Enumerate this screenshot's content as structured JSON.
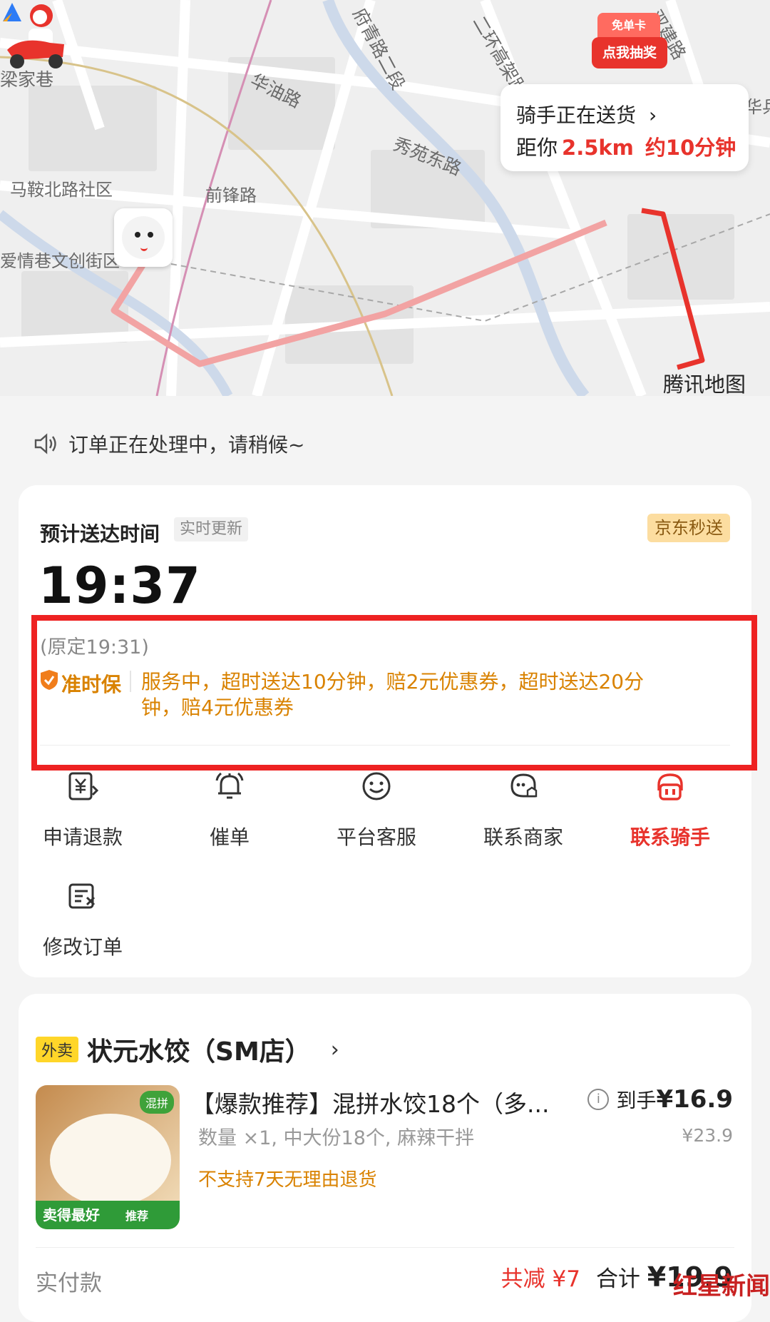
{
  "map": {
    "streets": [
      "梁家巷",
      "华油路",
      "府青路二段",
      "二环高架路",
      "双建路",
      "秀苑东路",
      "马鞍北路社区",
      "前锋路",
      "爱情巷文创街区",
      "华乒"
    ],
    "coupon": {
      "top": "免单卡",
      "bottom": "点我抽奖"
    },
    "rider": {
      "status": "骑手正在送货",
      "chevron": "›",
      "distance_prefix": "距你",
      "distance": "2.5km",
      "eta": "约10分钟"
    },
    "provider": "腾讯地图",
    "route_color": "#f28c8c",
    "active_route_color": "#e8332c"
  },
  "notice": "订单正在处理中，请稍候~",
  "delivery": {
    "eta_label": "预计送达时间",
    "realtime_tag": "实时更新",
    "brand_tag": "京东秒送",
    "eta": "19:37",
    "original": "(原定19:31)",
    "ontime_label": "准时保",
    "ontime_text": "服务中，超时送达10分钟，赔2元优惠券，超时送达20分钟，赔4元优惠券"
  },
  "actions": [
    {
      "label": "申请退款",
      "icon": "refund-icon"
    },
    {
      "label": "催单",
      "icon": "bell-icon"
    },
    {
      "label": "平台客服",
      "icon": "service-icon"
    },
    {
      "label": "联系商家",
      "icon": "merchant-chat-icon"
    },
    {
      "label": "联系骑手",
      "icon": "rider-icon",
      "highlight": true
    },
    {
      "label": "修改订单",
      "icon": "edit-order-icon"
    }
  ],
  "order": {
    "type_tag": "外卖",
    "shop_name": "状元水饺（SM店）",
    "chevron": "›",
    "item": {
      "image_tags": [
        "混拼",
        "卖得最好",
        "推荐"
      ],
      "title": "【爆款推荐】混拼水饺18个（多...",
      "spec": "数量 ×1, 中大份18个, 麻辣干拌",
      "policy": "不支持7天无理由退货",
      "net_label": "到手",
      "net_price": "¥16.9",
      "original_price": "¥23.9"
    },
    "pay_label": "实付款",
    "discount": "共减 ¥7",
    "total_label": "合计",
    "total": "¥19.9"
  },
  "watermark": "红星新闻"
}
